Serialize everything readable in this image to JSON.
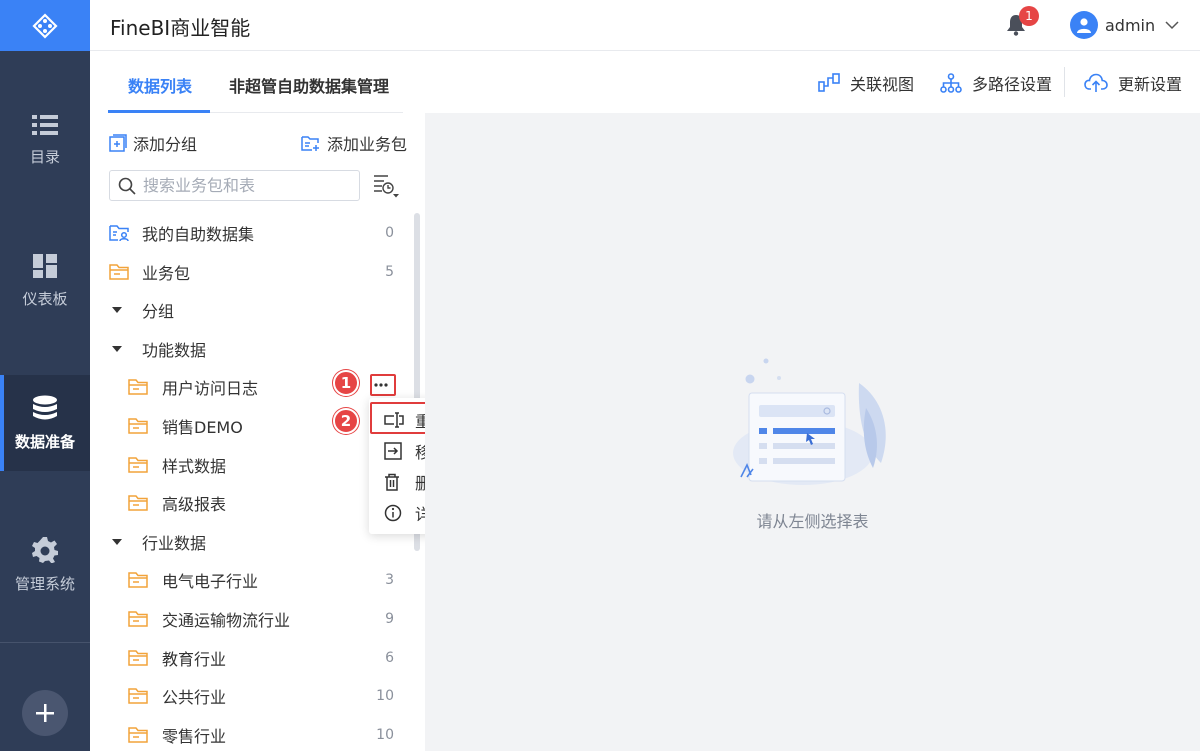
{
  "app": {
    "title": "FineBI商业智能"
  },
  "header": {
    "notification_count": "1",
    "username": "admin"
  },
  "nav": {
    "items": [
      {
        "label": "目录",
        "icon": "list-icon"
      },
      {
        "label": "仪表板",
        "icon": "dashboard-icon"
      },
      {
        "label": "数据准备",
        "icon": "database-icon",
        "active": true
      },
      {
        "label": "管理系统",
        "icon": "gear-icon"
      }
    ]
  },
  "tabs": [
    {
      "label": "数据列表",
      "active": true
    },
    {
      "label": "非超管自助数据集管理"
    }
  ],
  "toolbar": {
    "relation_view": "关联视图",
    "multipath": "多路径设置",
    "update_settings": "更新设置"
  },
  "panel": {
    "add_group": "添加分组",
    "add_package": "添加业务包",
    "search_placeholder": "搜索业务包和表"
  },
  "tree": [
    {
      "label": "我的自助数据集",
      "count": "0",
      "type": "self-dataset"
    },
    {
      "label": "业务包",
      "count": "5",
      "type": "folder"
    },
    {
      "label": "分组",
      "type": "group"
    },
    {
      "label": "功能数据",
      "type": "group"
    },
    {
      "label": "用户访问日志",
      "type": "child"
    },
    {
      "label": "销售DEMO",
      "type": "child"
    },
    {
      "label": "样式数据",
      "type": "child"
    },
    {
      "label": "高级报表",
      "type": "child"
    },
    {
      "label": "行业数据",
      "type": "group"
    },
    {
      "label": "电气电子行业",
      "count": "3",
      "type": "child"
    },
    {
      "label": "交通运输物流行业",
      "count": "9",
      "type": "child"
    },
    {
      "label": "教育行业",
      "count": "6",
      "type": "child"
    },
    {
      "label": "公共行业",
      "count": "10",
      "type": "child"
    },
    {
      "label": "零售行业",
      "count": "10",
      "type": "child"
    }
  ],
  "context_menu": {
    "rename": "重命名",
    "move_to": "移动到",
    "delete": "删除",
    "details": "详情"
  },
  "steps": [
    "1",
    "2"
  ],
  "empty_state": {
    "text": "请从左侧选择表"
  },
  "colors": {
    "accent": "#3a82f6",
    "nav_bg": "#2f3d57",
    "highlight": "#e03c3c",
    "folder": "#f2a33a"
  }
}
